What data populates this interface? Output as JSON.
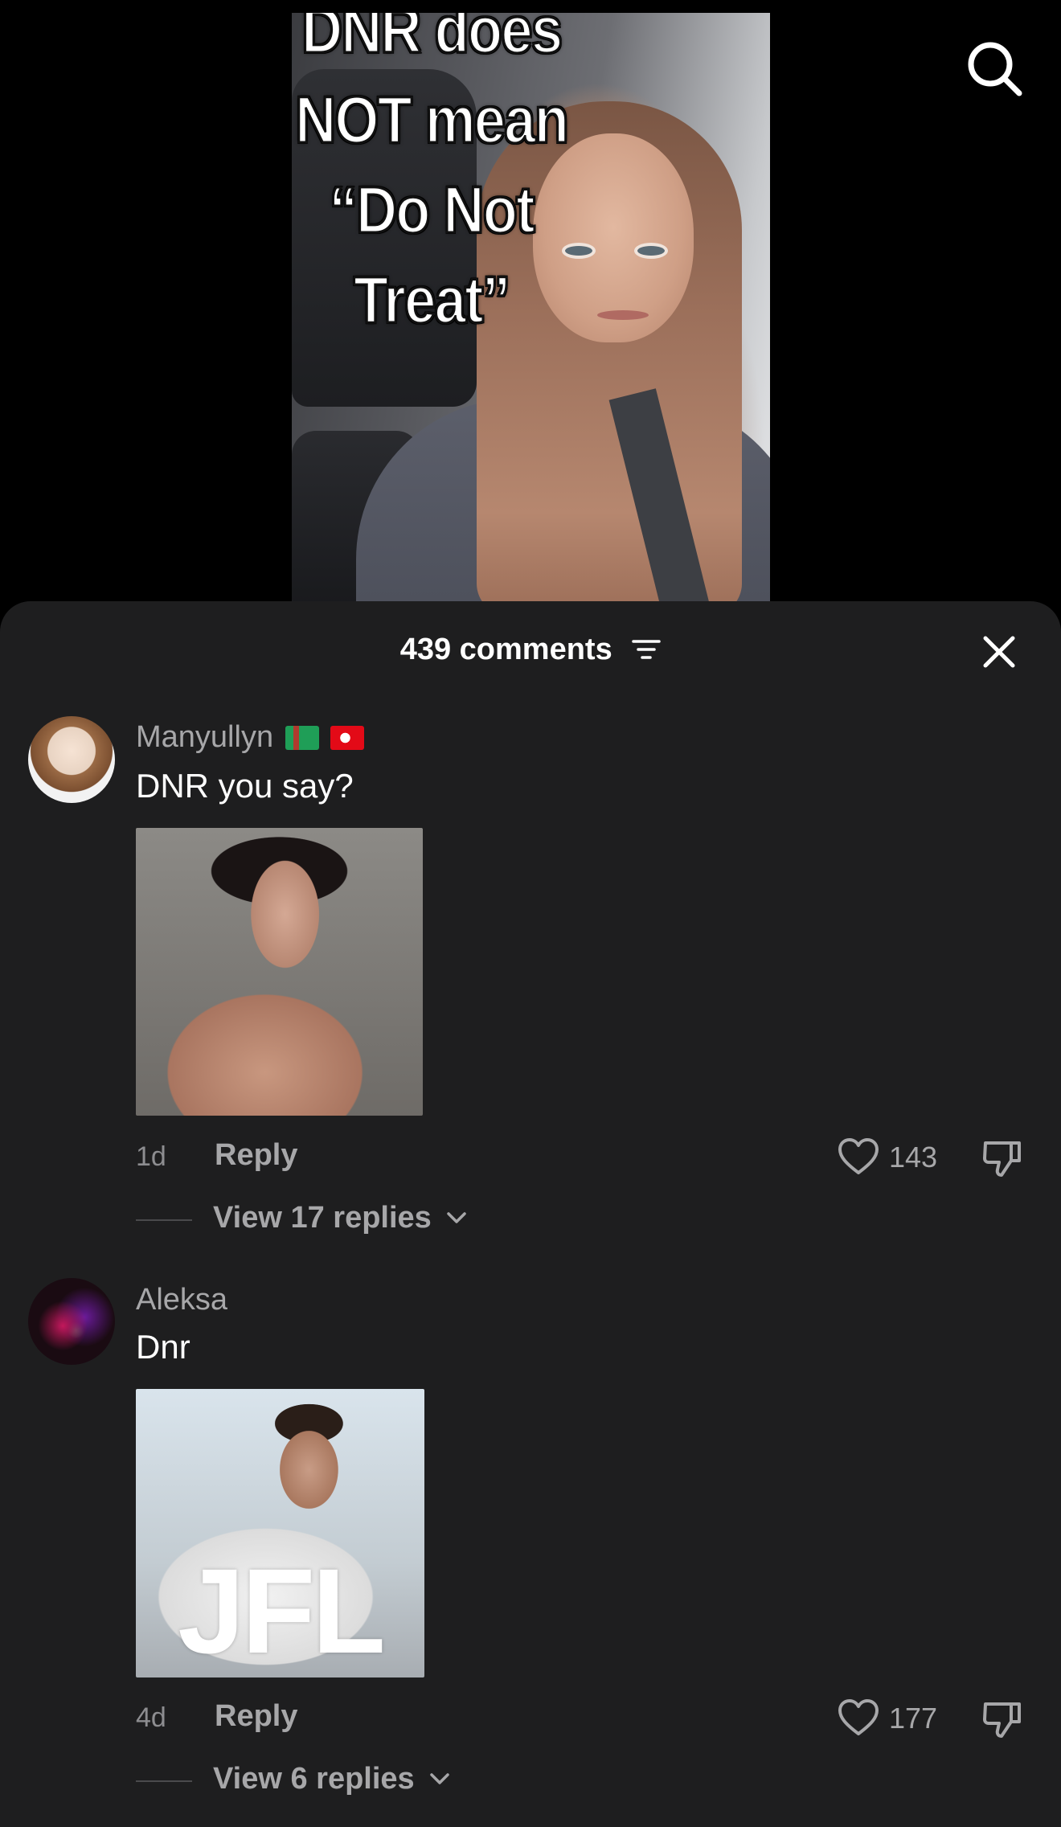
{
  "video": {
    "caption_lines": [
      "DNR does",
      "NOT mean",
      "“Do Not",
      "Treat”"
    ]
  },
  "icons": {
    "search": "search-icon",
    "sort": "sort-icon",
    "close": "close-icon",
    "heart": "heart-icon",
    "dislike": "thumbs-down-icon",
    "chevron": "chevron-down-icon"
  },
  "sheet": {
    "comments_count": "439 comments"
  },
  "comments": [
    {
      "username": "Manyullyn",
      "flags": [
        "Turkmenistan",
        "Turkey"
      ],
      "text": "DNR you say?",
      "time": "1d",
      "reply_label": "Reply",
      "likes": "143",
      "view_replies": "View 17 replies"
    },
    {
      "username": "Aleksa",
      "text": "Dnr",
      "attachment_text": "JFL",
      "time": "4d",
      "reply_label": "Reply",
      "likes": "177",
      "view_replies": "View 6 replies"
    }
  ],
  "colors": {
    "sheet_bg": "#1e1e1f",
    "muted_text": "#a7a7a9",
    "primary_text": "#ffffff"
  }
}
